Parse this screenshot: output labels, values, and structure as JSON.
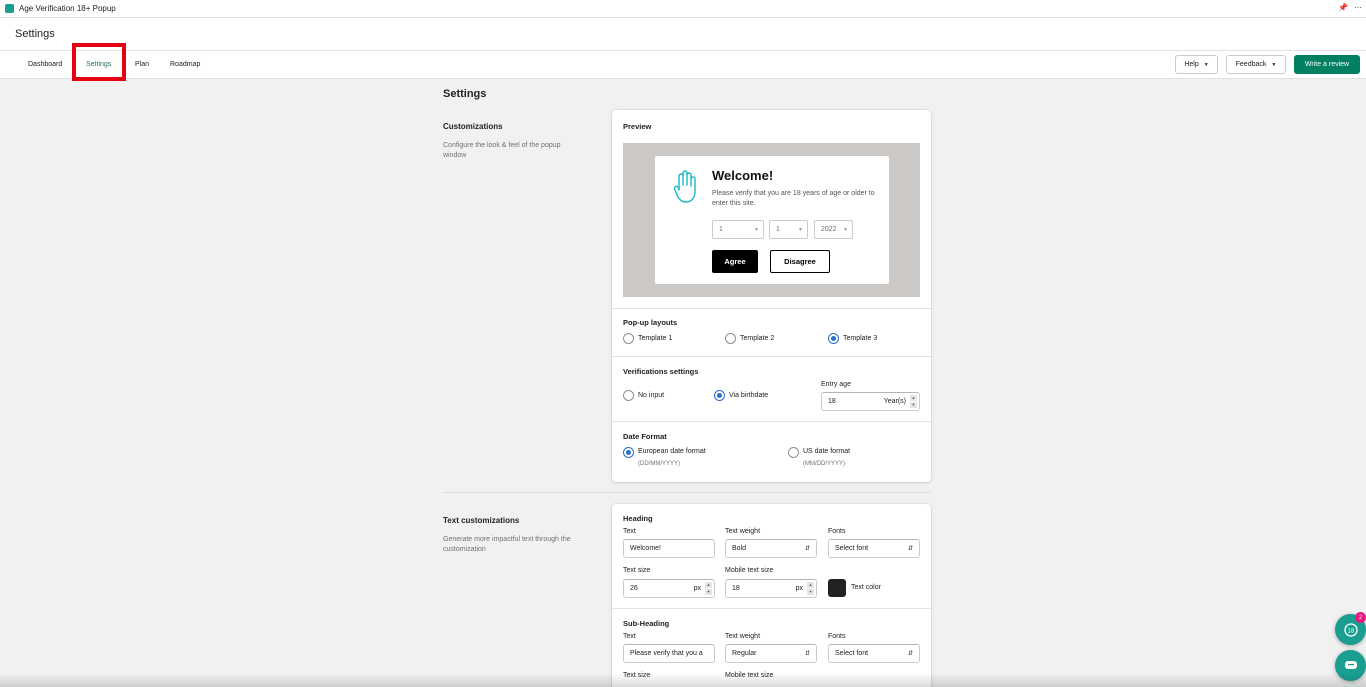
{
  "app": {
    "title": "Age Verification 18+ Popup",
    "pin_icon": "pin-icon",
    "more_icon": "more-icon"
  },
  "page": {
    "title": "Settings"
  },
  "tabs": [
    {
      "label": "Dashboard"
    },
    {
      "label": "Settings"
    },
    {
      "label": "Plan"
    },
    {
      "label": "Roadmap"
    }
  ],
  "header_buttons": {
    "help": "Help",
    "feedback": "Feedback",
    "write_review": "Write a review"
  },
  "main": {
    "title": "Settings",
    "customizations": {
      "heading": "Customizations",
      "description": "Configure the look & feel of the popup window"
    },
    "text_customizations": {
      "heading": "Text customizations",
      "description": "Generate more impactful text through the customization"
    }
  },
  "preview": {
    "title": "Preview",
    "heading": "Welcome!",
    "subheading": "Please verify that you are 18 years of age or older to enter this site.",
    "day": "1",
    "month": "1",
    "year": "2022",
    "agree": "Agree",
    "disagree": "Disagree"
  },
  "layouts": {
    "title": "Pop-up layouts",
    "options": [
      "Template 1",
      "Template 2",
      "Template 3"
    ],
    "selected": "Template 3"
  },
  "verification": {
    "title": "Verifications settings",
    "options": [
      "No input",
      "Via birthdate"
    ],
    "selected": "Via birthdate",
    "entry_age_label": "Entry age",
    "entry_age_value": "18",
    "entry_age_suffix": "Year(s)"
  },
  "date_format": {
    "title": "Date Format",
    "european": {
      "label": "European date format",
      "hint": "(DD/MM/YYYY)"
    },
    "us": {
      "label": "US date format",
      "hint": "(MM/DD/YYYY)"
    },
    "selected": "European date format"
  },
  "heading_text": {
    "title": "Heading",
    "text_label": "Text",
    "text_value": "Welcome!",
    "weight_label": "Text weight",
    "weight_value": "Bold",
    "fonts_label": "Fonts",
    "fonts_value": "Select font",
    "size_label": "Text size",
    "size_value": "26",
    "size_unit": "px",
    "mobile_label": "Mobile text size",
    "mobile_value": "18",
    "mobile_unit": "px",
    "color_label": "Text color",
    "color": "#222222"
  },
  "subheading_text": {
    "title": "Sub-Heading",
    "text_label": "Text",
    "text_value": "Please verify that you a",
    "weight_label": "Text weight",
    "weight_value": "Regular",
    "fonts_label": "Fonts",
    "fonts_value": "Select font",
    "size_label": "Text size",
    "mobile_label": "Mobile text size"
  },
  "widget": {
    "badge": "2",
    "chat_icon": "chat-icon",
    "age-badge-icon": "18+ badge"
  },
  "colors": {
    "primary": "#008060",
    "accent": "#1a9e8f",
    "highlight": "#e60012",
    "radio": "#2c6ecb"
  }
}
